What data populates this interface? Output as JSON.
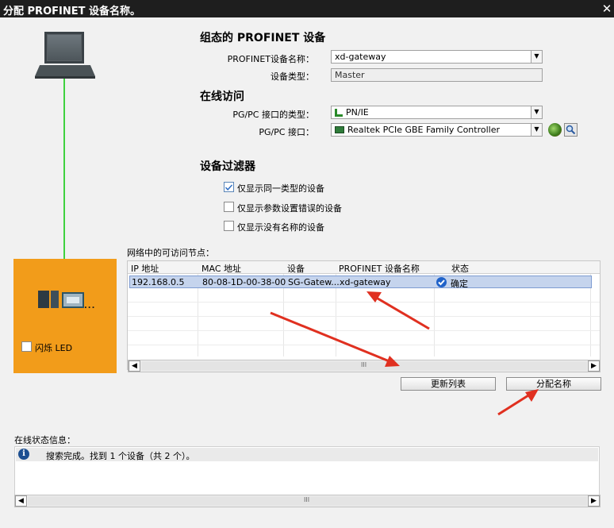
{
  "window": {
    "title": "分配 PROFINET 设备名称。",
    "close_glyph": "✕"
  },
  "configured_device": {
    "heading": "组态的 PROFINET 设备",
    "name_label": "PROFINET设备名称：",
    "name_value": "xd-gateway",
    "type_label": "设备类型：",
    "type_value": "Master"
  },
  "online_access": {
    "heading": "在线访问",
    "interface_type_label": "PG/PC 接口的类型：",
    "interface_type_value": "PN/IE",
    "interface_label": "PG/PC 接口：",
    "interface_value": "Realtek PCIe GBE Family Controller"
  },
  "device_filter": {
    "heading": "设备过滤器",
    "options": [
      {
        "label": "仅显示同一类型的设备",
        "checked": true
      },
      {
        "label": "仅显示参数设置错误的设备",
        "checked": false
      },
      {
        "label": "仅显示没有名称的设备",
        "checked": false
      }
    ]
  },
  "device_panel": {
    "flash_led_label": "闪烁 LED",
    "flash_led_checked": false
  },
  "nodes": {
    "caption": "网络中的可访问节点：",
    "columns": [
      "IP 地址",
      "MAC 地址",
      "设备",
      "PROFINET 设备名称",
      "状态"
    ],
    "rows": [
      {
        "ip": "192.168.0.5",
        "mac": "80-08-1D-00-38-00",
        "device": "SG-Gatew...",
        "name": "xd-gateway",
        "status": "确定"
      }
    ],
    "scroll_mid": "III"
  },
  "buttons": {
    "refresh": "更新列表",
    "assign": "分配名称"
  },
  "status": {
    "caption": "在线状态信息：",
    "message": "搜索完成。找到 1 个设备（共 2 个）。",
    "scroll_mid": "III"
  },
  "colors": {
    "orange_panel": "#f29c1a",
    "green_link": "#3fd23f",
    "arrow": "#e03020",
    "selection": "#c5d4ed"
  }
}
